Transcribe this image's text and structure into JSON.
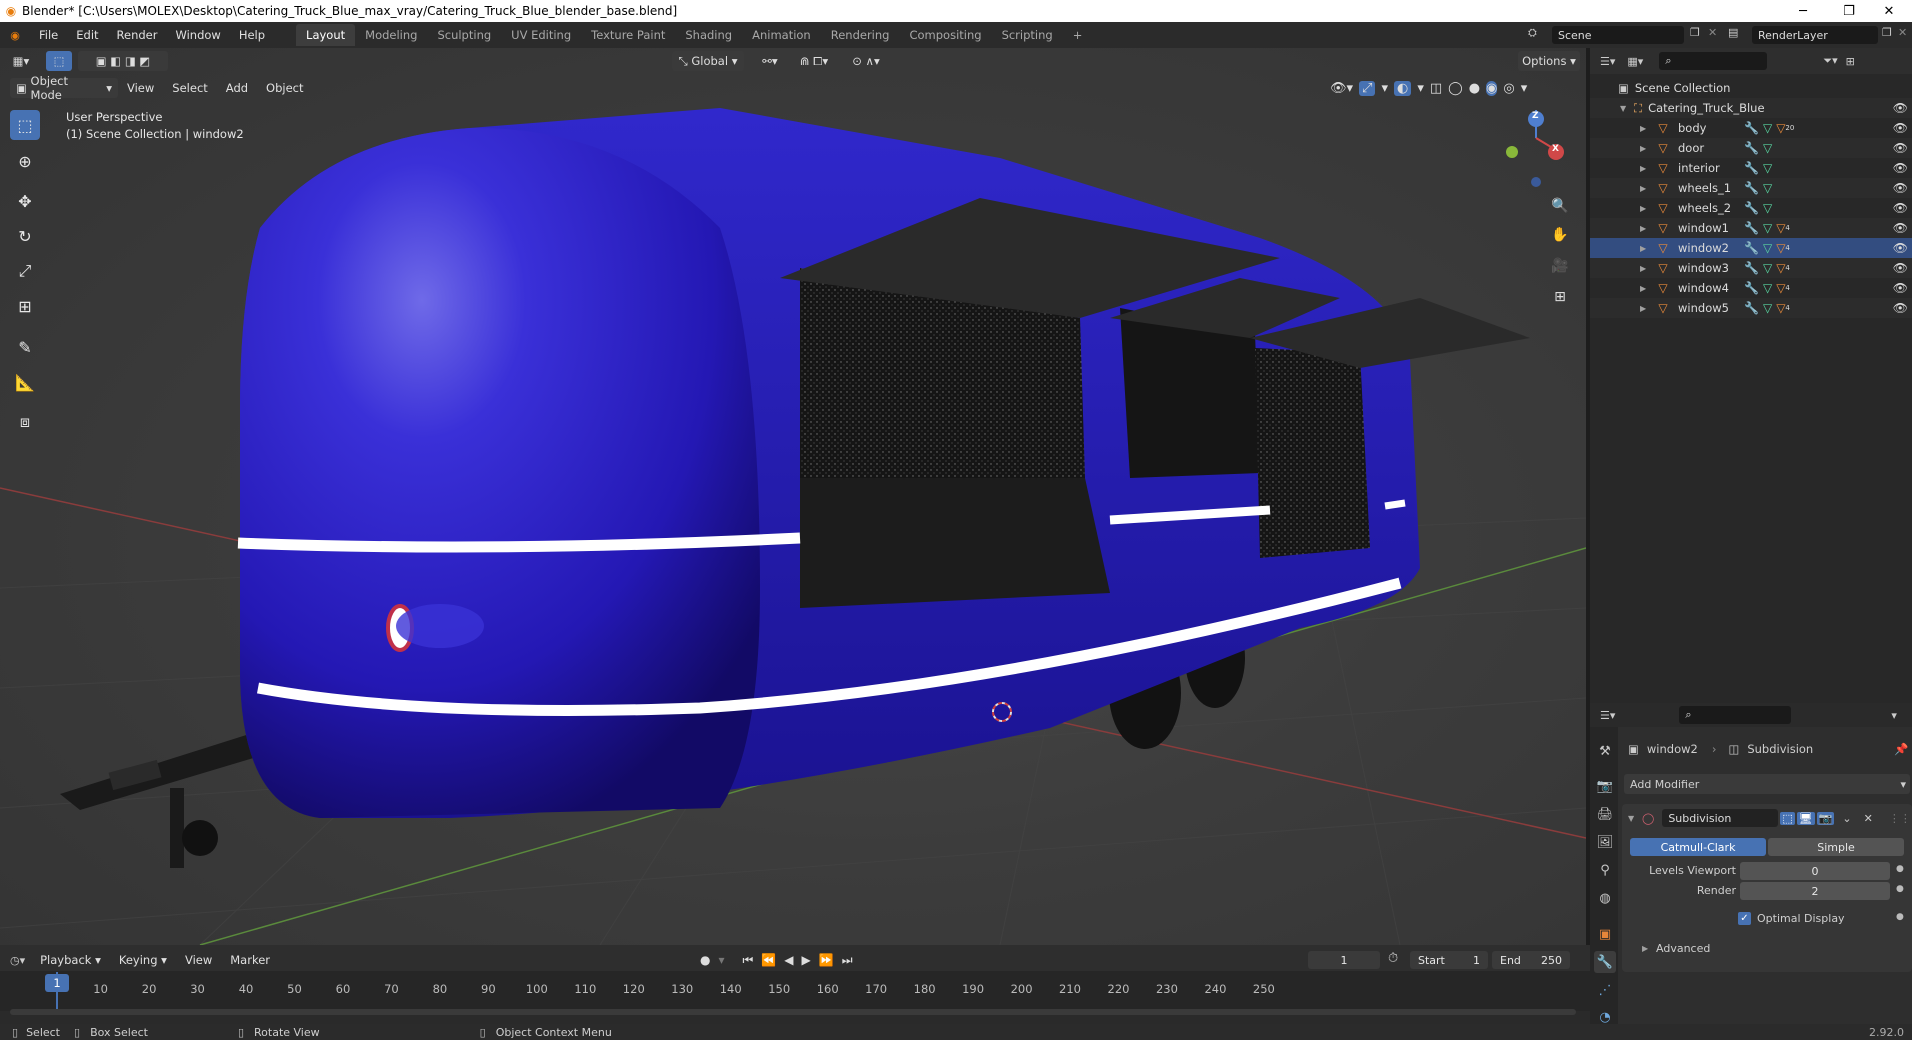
{
  "title_bar": {
    "text": "Blender* [C:\\Users\\MOLEX\\Desktop\\Catering_Truck_Blue_max_vray/Catering_Truck_Blue_blender_base.blend]"
  },
  "menu": [
    "File",
    "Edit",
    "Render",
    "Window",
    "Help"
  ],
  "workspaces": [
    "Layout",
    "Modeling",
    "Sculpting",
    "UV Editing",
    "Texture Paint",
    "Shading",
    "Animation",
    "Rendering",
    "Compositing",
    "Scripting"
  ],
  "active_workspace": "Layout",
  "scene_field": "Scene",
  "renderlayer_field": "RenderLayer",
  "viewport_header": {
    "mode": "Object Mode",
    "menus": [
      "View",
      "Select",
      "Add",
      "Object"
    ],
    "transform": "Global",
    "options": "Options"
  },
  "viewport_overlay": {
    "line1": "User Perspective",
    "line2": "(1) Scene Collection | window2"
  },
  "gizmo": {
    "z": "Z",
    "x": "X"
  },
  "outliner": {
    "root": "Scene Collection",
    "collection": "Catering_Truck_Blue",
    "objects": [
      {
        "name": "body",
        "mat_count": "20"
      },
      {
        "name": "door",
        "mat_count": ""
      },
      {
        "name": "interior",
        "mat_count": ""
      },
      {
        "name": "wheels_1",
        "mat_count": ""
      },
      {
        "name": "wheels_2",
        "mat_count": ""
      },
      {
        "name": "window1",
        "mat_count": "4"
      },
      {
        "name": "window2",
        "mat_count": "4"
      },
      {
        "name": "window3",
        "mat_count": "4"
      },
      {
        "name": "window4",
        "mat_count": "4"
      },
      {
        "name": "window5",
        "mat_count": "4"
      }
    ],
    "selected": "window2"
  },
  "properties": {
    "object": "window2",
    "modifier_name_header": "Subdivision",
    "add_modifier": "Add Modifier",
    "modifier_name": "Subdivision",
    "type_a": "Catmull-Clark",
    "type_b": "Simple",
    "levels_viewport_label": "Levels Viewport",
    "levels_viewport": "0",
    "render_label": "Render",
    "render": "2",
    "optimal_display": "Optimal Display",
    "advanced": "Advanced"
  },
  "timeline": {
    "menus": [
      "Playback",
      "Keying",
      "View",
      "Marker"
    ],
    "current_frame": "1",
    "start_label": "Start",
    "start": "1",
    "end_label": "End",
    "end": "250",
    "ticks": [
      "1",
      "10",
      "20",
      "30",
      "40",
      "50",
      "60",
      "70",
      "80",
      "90",
      "100",
      "110",
      "120",
      "130",
      "140",
      "150",
      "160",
      "170",
      "180",
      "190",
      "200",
      "210",
      "220",
      "230",
      "240",
      "250"
    ]
  },
  "statusbar": {
    "select": "Select",
    "box_select": "Box Select",
    "rotate_view": "Rotate View",
    "context_menu": "Object Context Menu",
    "version": "2.92.0"
  },
  "colors": {
    "accent": "#4772b3",
    "truck": "#2a22c8",
    "object_orange": "#e88a3a"
  }
}
